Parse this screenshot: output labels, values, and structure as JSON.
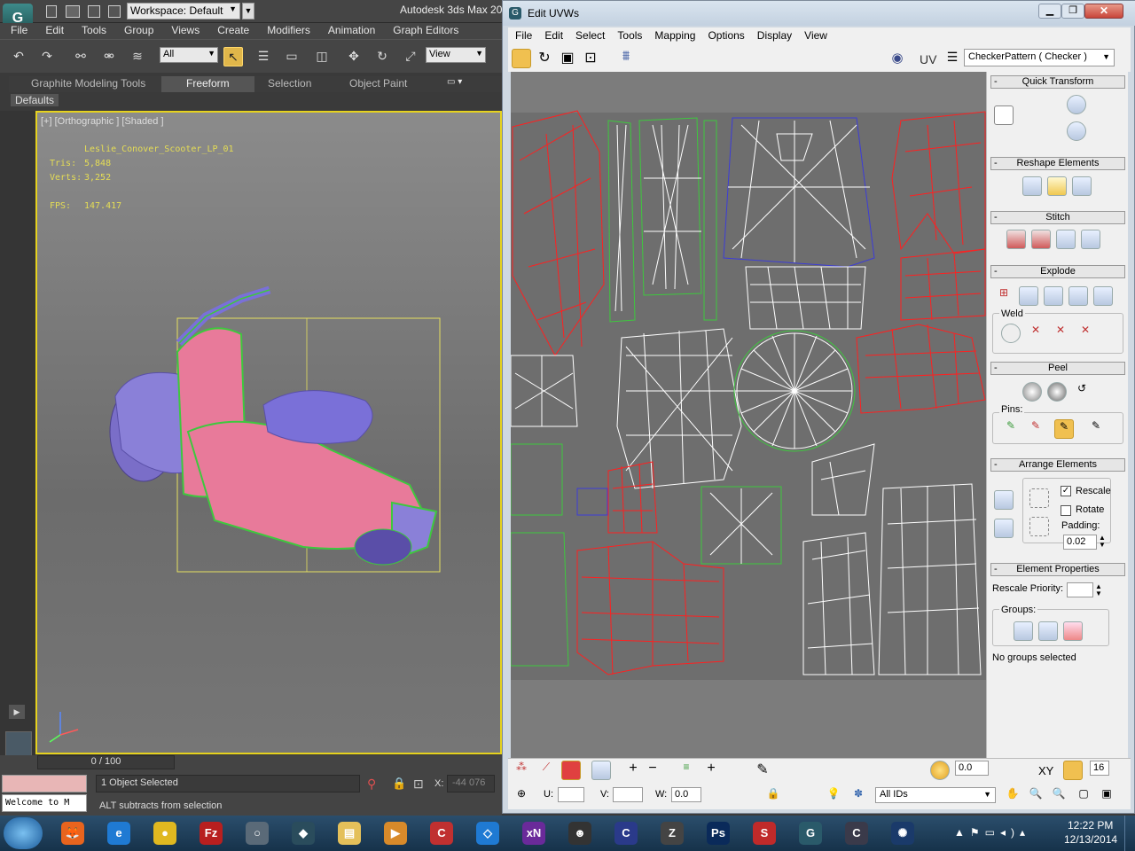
{
  "max": {
    "workspace": "Workspace: Default",
    "app_title": "Autodesk 3ds Max  20",
    "menu": [
      "File",
      "Edit",
      "Tools",
      "Group",
      "Views",
      "Create",
      "Modifiers",
      "Animation",
      "Graph Editors"
    ],
    "selection_filter": "All",
    "ref_coord": "View",
    "ribbon_tabs": [
      "Graphite Modeling Tools",
      "Freeform",
      "Selection",
      "Object Paint"
    ],
    "defaults_label": "Defaults",
    "viewport_label": "[+] [Orthographic ] [Shaded ]",
    "object_name": "Leslie_Conover_Scooter_LP_01",
    "tris_label": "Tris:",
    "tris_value": "5,848",
    "verts_label": "Verts:",
    "verts_value": "3,252",
    "fps_label": "FPS:",
    "fps_value": "147.417",
    "time_slider": "0 / 100",
    "selection_status": "1 Object Selected",
    "prompt": "ALT subtracts from selection",
    "maxscript": "Welcome to M",
    "x_label": "X:",
    "x_value": "-44 076"
  },
  "uv": {
    "title": "Edit UVWs",
    "menu": [
      "File",
      "Edit",
      "Select",
      "Tools",
      "Mapping",
      "Options",
      "Display",
      "View"
    ],
    "uv_label": "UV",
    "texture": "CheckerPattern  ( Checker )",
    "rollouts": {
      "quick_transform": "Quick Transform",
      "reshape": "Reshape Elements",
      "stitch": "Stitch",
      "explode": "Explode",
      "weld": "Weld",
      "peel": "Peel",
      "pins": "Pins:",
      "arrange": "Arrange Elements",
      "rescale": "Rescale",
      "rotate": "Rotate",
      "padding_label": "Padding:",
      "padding_value": "0.02",
      "element_props": "Element Properties",
      "rescale_priority": "Rescale Priority:",
      "groups": "Groups:",
      "no_groups": "No groups selected"
    },
    "bottom": {
      "soft_value": "0.0",
      "xy": "XY",
      "grid_value": "16",
      "u_label": "U:",
      "v_label": "V:",
      "w_label": "W:",
      "w_value": "0.0",
      "ids": "All IDs"
    }
  },
  "taskbar": {
    "time": "12:22 PM",
    "date": "12/13/2014",
    "apps": [
      {
        "name": "firefox",
        "color": "#e8641e",
        "glyph": "🦊"
      },
      {
        "name": "ie",
        "color": "#1f7ad3",
        "glyph": "e"
      },
      {
        "name": "chrome",
        "color": "#e0b820",
        "glyph": "●"
      },
      {
        "name": "filezilla",
        "color": "#b81f1f",
        "glyph": "Fz"
      },
      {
        "name": "tool",
        "color": "#5a6a78",
        "glyph": "○"
      },
      {
        "name": "3dsmax-a",
        "color": "#2a4c5c",
        "glyph": "◆"
      },
      {
        "name": "explorer",
        "color": "#e4c05a",
        "glyph": "▤"
      },
      {
        "name": "media",
        "color": "#d88a2a",
        "glyph": "▶"
      },
      {
        "name": "ccleaner",
        "color": "#c03030",
        "glyph": "C"
      },
      {
        "name": "dropbox",
        "color": "#1f7ad3",
        "glyph": "◇"
      },
      {
        "name": "xnview",
        "color": "#6a2a9a",
        "glyph": "xN"
      },
      {
        "name": "avatar",
        "color": "#333",
        "glyph": "☻"
      },
      {
        "name": "app",
        "color": "#2a3a8a",
        "glyph": "C"
      },
      {
        "name": "zbrush",
        "color": "#444",
        "glyph": "Z"
      },
      {
        "name": "photoshop",
        "color": "#0a2a5a",
        "glyph": "Ps"
      },
      {
        "name": "substance",
        "color": "#c02a2a",
        "glyph": "S"
      },
      {
        "name": "3dsmax",
        "color": "#2a5a6a",
        "glyph": "G"
      },
      {
        "name": "app2",
        "color": "#3a3a4a",
        "glyph": "C"
      },
      {
        "name": "app3",
        "color": "#1a3a6a",
        "glyph": "✺"
      }
    ]
  }
}
